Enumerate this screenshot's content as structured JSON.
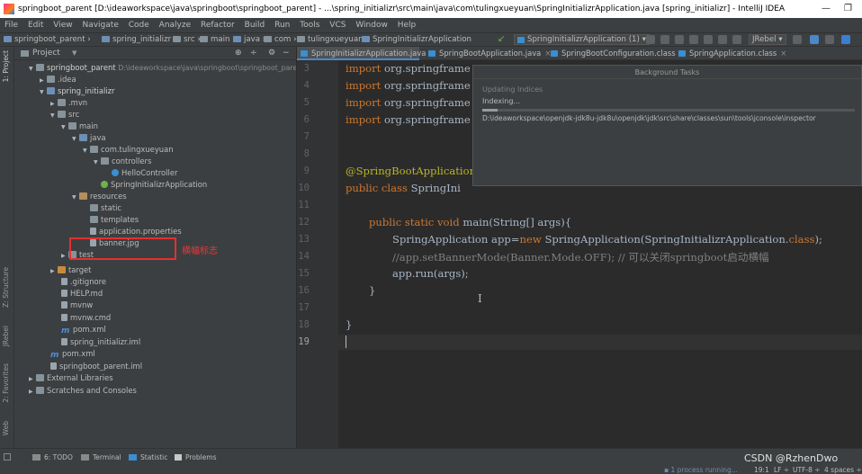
{
  "window": {
    "title": "springboot_parent [D:\\ideaworkspace\\java\\springboot\\springboot_parent] - ...\\spring_initializr\\src\\main\\java\\com\\tulingxueyuan\\SpringInitializrApplication.java [spring_initializr] - IntelliJ IDEA",
    "minimize": "—",
    "restore": "❐"
  },
  "menu": [
    "File",
    "Edit",
    "View",
    "Navigate",
    "Code",
    "Analyze",
    "Refactor",
    "Build",
    "Run",
    "Tools",
    "VCS",
    "Window",
    "Help"
  ],
  "breadcrumb": [
    "springboot_parent",
    "spring_initializr",
    "src",
    "main",
    "java",
    "com",
    "tulingxueyuan",
    "SpringInitializrApplication"
  ],
  "toolbar": {
    "run_config": "SpringInitializrApplication (1)",
    "jrebel": "JRebel"
  },
  "side_tabs": {
    "project": "1: Project",
    "structure": "Z: Structure",
    "jrebel": "JRebel",
    "favorites": "2: Favorites",
    "web": "Web"
  },
  "project_panel": {
    "title": "Project",
    "tree": [
      {
        "label": "springboot_parent",
        "hint": "D:\\ideaworkspace\\java\\springboot\\springboot_parent",
        "icon": "folder",
        "arrow": "▼"
      },
      {
        "label": ".idea",
        "icon": "folder",
        "arrow": "▶"
      },
      {
        "label": "spring_initializr",
        "icon": "folder",
        "arrow": "▼"
      },
      {
        "label": ".mvn",
        "icon": "folder",
        "arrow": "▶"
      },
      {
        "label": "src",
        "icon": "folder",
        "arrow": "▼"
      },
      {
        "label": "main",
        "icon": "folder",
        "arrow": "▼"
      },
      {
        "label": "java",
        "icon": "src",
        "arrow": "▼"
      },
      {
        "label": "com.tulingxueyuan",
        "icon": "folder",
        "arrow": "▼"
      },
      {
        "label": "controllers",
        "icon": "folder",
        "arrow": "▼"
      },
      {
        "label": "HelloController",
        "icon": "cls",
        "arrow": ""
      },
      {
        "label": "SpringInitializrApplication",
        "icon": "spring",
        "arrow": ""
      },
      {
        "label": "resources",
        "icon": "res",
        "arrow": "▼"
      },
      {
        "label": "static",
        "icon": "folder",
        "arrow": ""
      },
      {
        "label": "templates",
        "icon": "folder",
        "arrow": ""
      },
      {
        "label": "application.properties",
        "icon": "file",
        "arrow": ""
      },
      {
        "label": "banner.jpg",
        "icon": "file",
        "arrow": ""
      },
      {
        "label": "test",
        "icon": "folder",
        "arrow": "▶"
      },
      {
        "label": "target",
        "icon": "target",
        "arrow": "▶"
      },
      {
        "label": ".gitignore",
        "icon": "file",
        "arrow": ""
      },
      {
        "label": "HELP.md",
        "icon": "file",
        "arrow": ""
      },
      {
        "label": "mvnw",
        "icon": "file",
        "arrow": ""
      },
      {
        "label": "mvnw.cmd",
        "icon": "file",
        "arrow": ""
      },
      {
        "label": "pom.xml",
        "icon": "m",
        "arrow": ""
      },
      {
        "label": "spring_initializr.iml",
        "icon": "file",
        "arrow": ""
      },
      {
        "label": "pom.xml",
        "icon": "m",
        "arrow": ""
      },
      {
        "label": "springboot_parent.iml",
        "icon": "file",
        "arrow": ""
      },
      {
        "label": "External Libraries",
        "icon": "folder",
        "arrow": "▶"
      },
      {
        "label": "Scratches and Consoles",
        "icon": "folder",
        "arrow": "▶"
      }
    ],
    "annotation": "横幅标志"
  },
  "editor_tabs": [
    {
      "label": "SpringInitializrApplication.java",
      "active": true
    },
    {
      "label": "SpringBootApplication.java",
      "active": false
    },
    {
      "label": "SpringBootConfiguration.class",
      "active": false
    },
    {
      "label": "SpringApplication.class",
      "active": false
    }
  ],
  "editor": {
    "line_numbers": [
      "3",
      "4",
      "5",
      "6",
      "7",
      "8",
      "9",
      "10",
      "11",
      "12",
      "13",
      "14",
      "15",
      "16",
      "17",
      "18",
      "19"
    ],
    "lines": {
      "l3": {
        "kw": "import",
        "rest": " org.springframe"
      },
      "l4": {
        "kw": "import",
        "rest": " org.springframe"
      },
      "l5": {
        "kw": "import",
        "rest": " org.springframe"
      },
      "l6": {
        "kw": "import",
        "rest": " org.springframe"
      },
      "l9": {
        "ann": "@SpringBootApplication"
      },
      "l10": {
        "kw": "public class",
        "rest": " SpringIni"
      },
      "l12": {
        "kw": "public static void",
        "rest": " main(String[] args){"
      },
      "l13": {
        "pre": "SpringApplication app=",
        "kw": "new",
        "rest": " SpringApplication(SpringInitializrApplication.",
        "kw2": "class",
        "tail": ");"
      },
      "l14": {
        "cmt": "//app.setBannerMode(Banner.Mode.OFF); // 可以关闭springboot启动横幅"
      },
      "l15": {
        "text": "app.run(args);"
      },
      "l16": {
        "text": "}"
      },
      "l18": {
        "text": "}"
      }
    }
  },
  "background_tasks": {
    "title": "Background Tasks",
    "updating": "Updating Indices",
    "indexing": "Indexing...",
    "progress": 0.04,
    "path": "D:\\ideaworkspace\\openjdk-jdk8u-jdk8u\\openjdk\\jdk\\src\\share\\classes\\sun\\tools\\jconsole\\inspector"
  },
  "bottom_tools": [
    "6: TODO",
    "Terminal",
    "Statistic",
    "Problems"
  ],
  "status": {
    "running": "1 process running...",
    "position": "19:1",
    "line_sep": "LF ÷",
    "encoding": "UTF-8 ÷",
    "indent": "4 spaces ÷"
  },
  "watermark": "CSDN @RzhenDwo"
}
